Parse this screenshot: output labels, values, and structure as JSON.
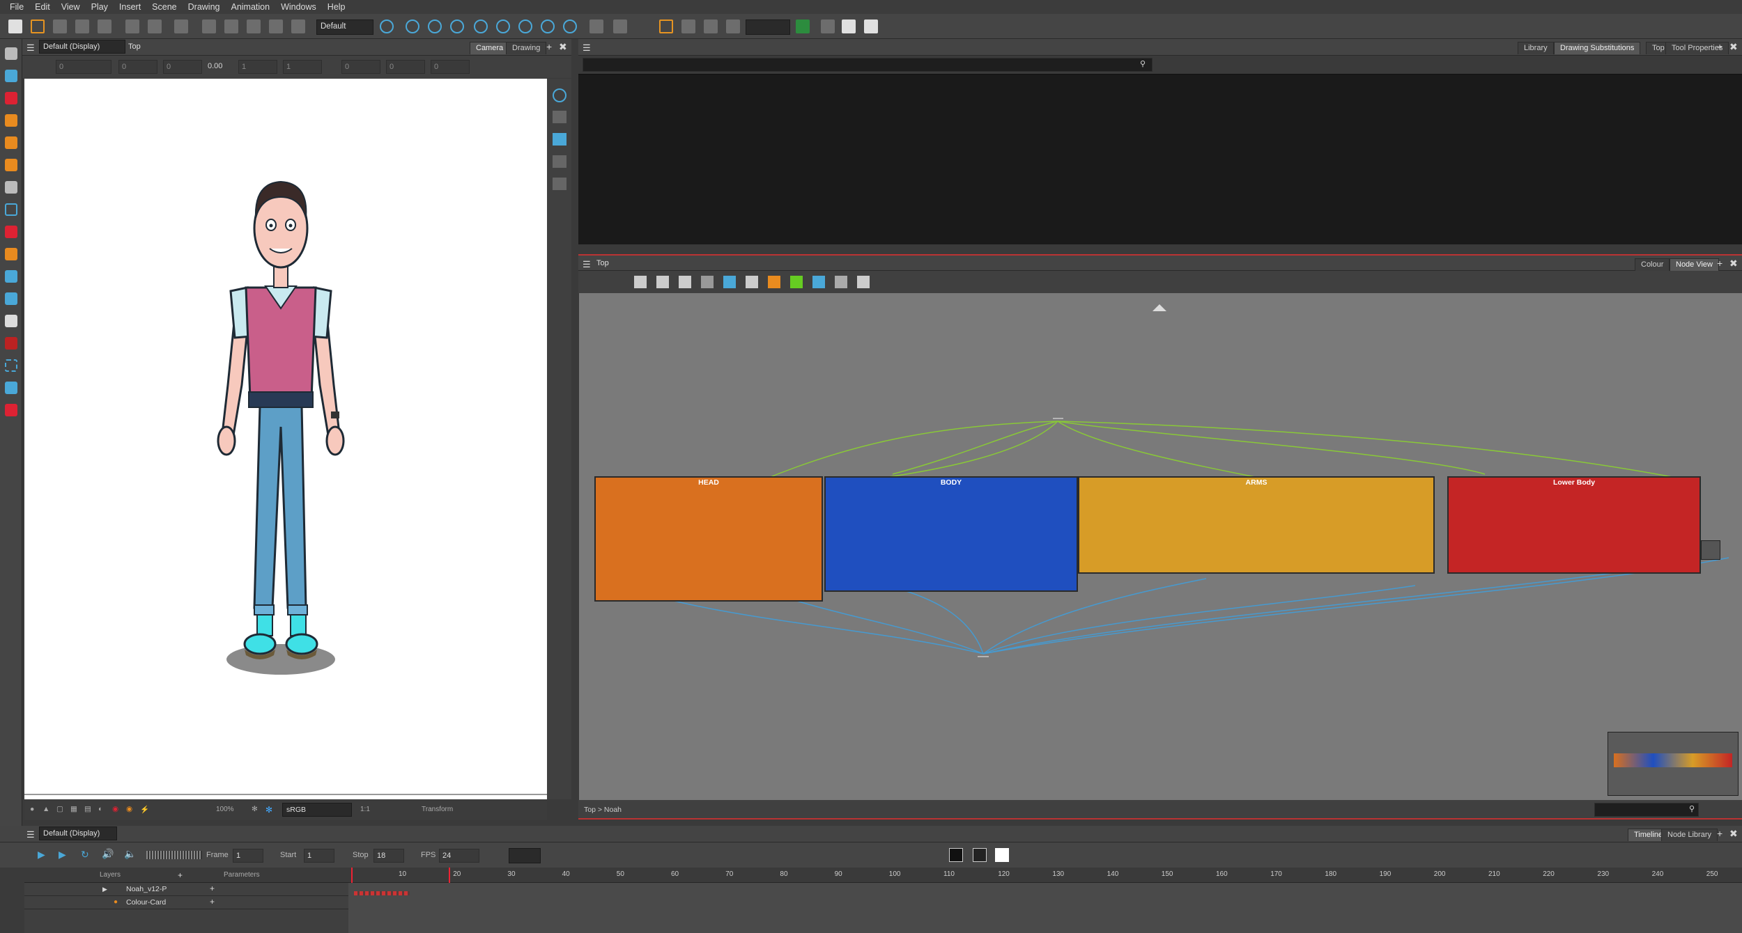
{
  "menu": [
    "File",
    "Edit",
    "View",
    "Play",
    "Insert",
    "Scene",
    "Drawing",
    "Animation",
    "Windows",
    "Help"
  ],
  "toolbar": {
    "workspace": "Default",
    "blank_combo": ""
  },
  "camera_view": {
    "display": "Default (Display)",
    "breadcrumb": "Top",
    "tabs": [
      "Camera",
      "Drawing"
    ],
    "fields": [
      "0",
      "0",
      "0",
      "0.00",
      "1",
      "1",
      "0",
      "0",
      "0"
    ],
    "zoom": "100%",
    "colorspace": "sRGB",
    "ratio": "1:1",
    "mode": "Transform"
  },
  "library": {
    "tabs": [
      "Library",
      "Drawing Substitutions",
      "Top",
      "Tool Properties"
    ],
    "search_placeholder": ""
  },
  "node_view": {
    "breadcrumb": "Top",
    "tabs": [
      "Colour",
      "Node View"
    ],
    "groups": [
      {
        "name": "HEAD",
        "color": "#d9701f"
      },
      {
        "name": "BODY",
        "color": "#1f4fbf"
      },
      {
        "name": "ARMS",
        "color": "#d79c27"
      },
      {
        "name": "Lower Body",
        "color": "#c42525"
      }
    ],
    "path": "Top > Noah"
  },
  "timeline": {
    "display": "Default (Display)",
    "tabs": [
      "Timeline",
      "Node Library"
    ],
    "frame_label": "Frame",
    "frame": "1",
    "start_label": "Start",
    "start": "1",
    "stop_label": "Stop",
    "stop": "18",
    "fps_label": "FPS",
    "fps": "24",
    "layers_header": "Layers",
    "params_header": "Parameters",
    "layers": [
      "Noah_v12-P",
      "Colour-Card"
    ],
    "ruler": [
      "10",
      "20",
      "30",
      "40",
      "50",
      "60",
      "70",
      "80",
      "90",
      "100",
      "110",
      "120",
      "130",
      "140",
      "150",
      "160",
      "170",
      "180",
      "190",
      "200",
      "210",
      "220",
      "230",
      "240",
      "250"
    ]
  }
}
